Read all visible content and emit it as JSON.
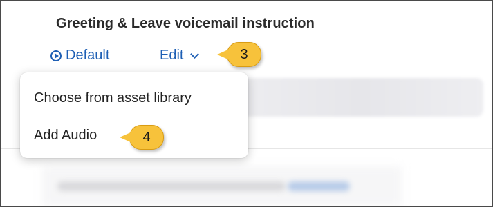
{
  "section": {
    "title": "Greeting & Leave voicemail instruction",
    "default_label": "Default",
    "edit_label": "Edit"
  },
  "menu": {
    "items": [
      {
        "label": "Choose from asset library"
      },
      {
        "label": "Add Audio"
      }
    ]
  },
  "callouts": {
    "step_3": "3",
    "step_4": "4"
  },
  "colors": {
    "link": "#1e5fb4",
    "callout": "#f7c23b",
    "text": "#2b2b2b"
  },
  "icons": [
    "play-circle-icon",
    "chevron-down-icon"
  ]
}
